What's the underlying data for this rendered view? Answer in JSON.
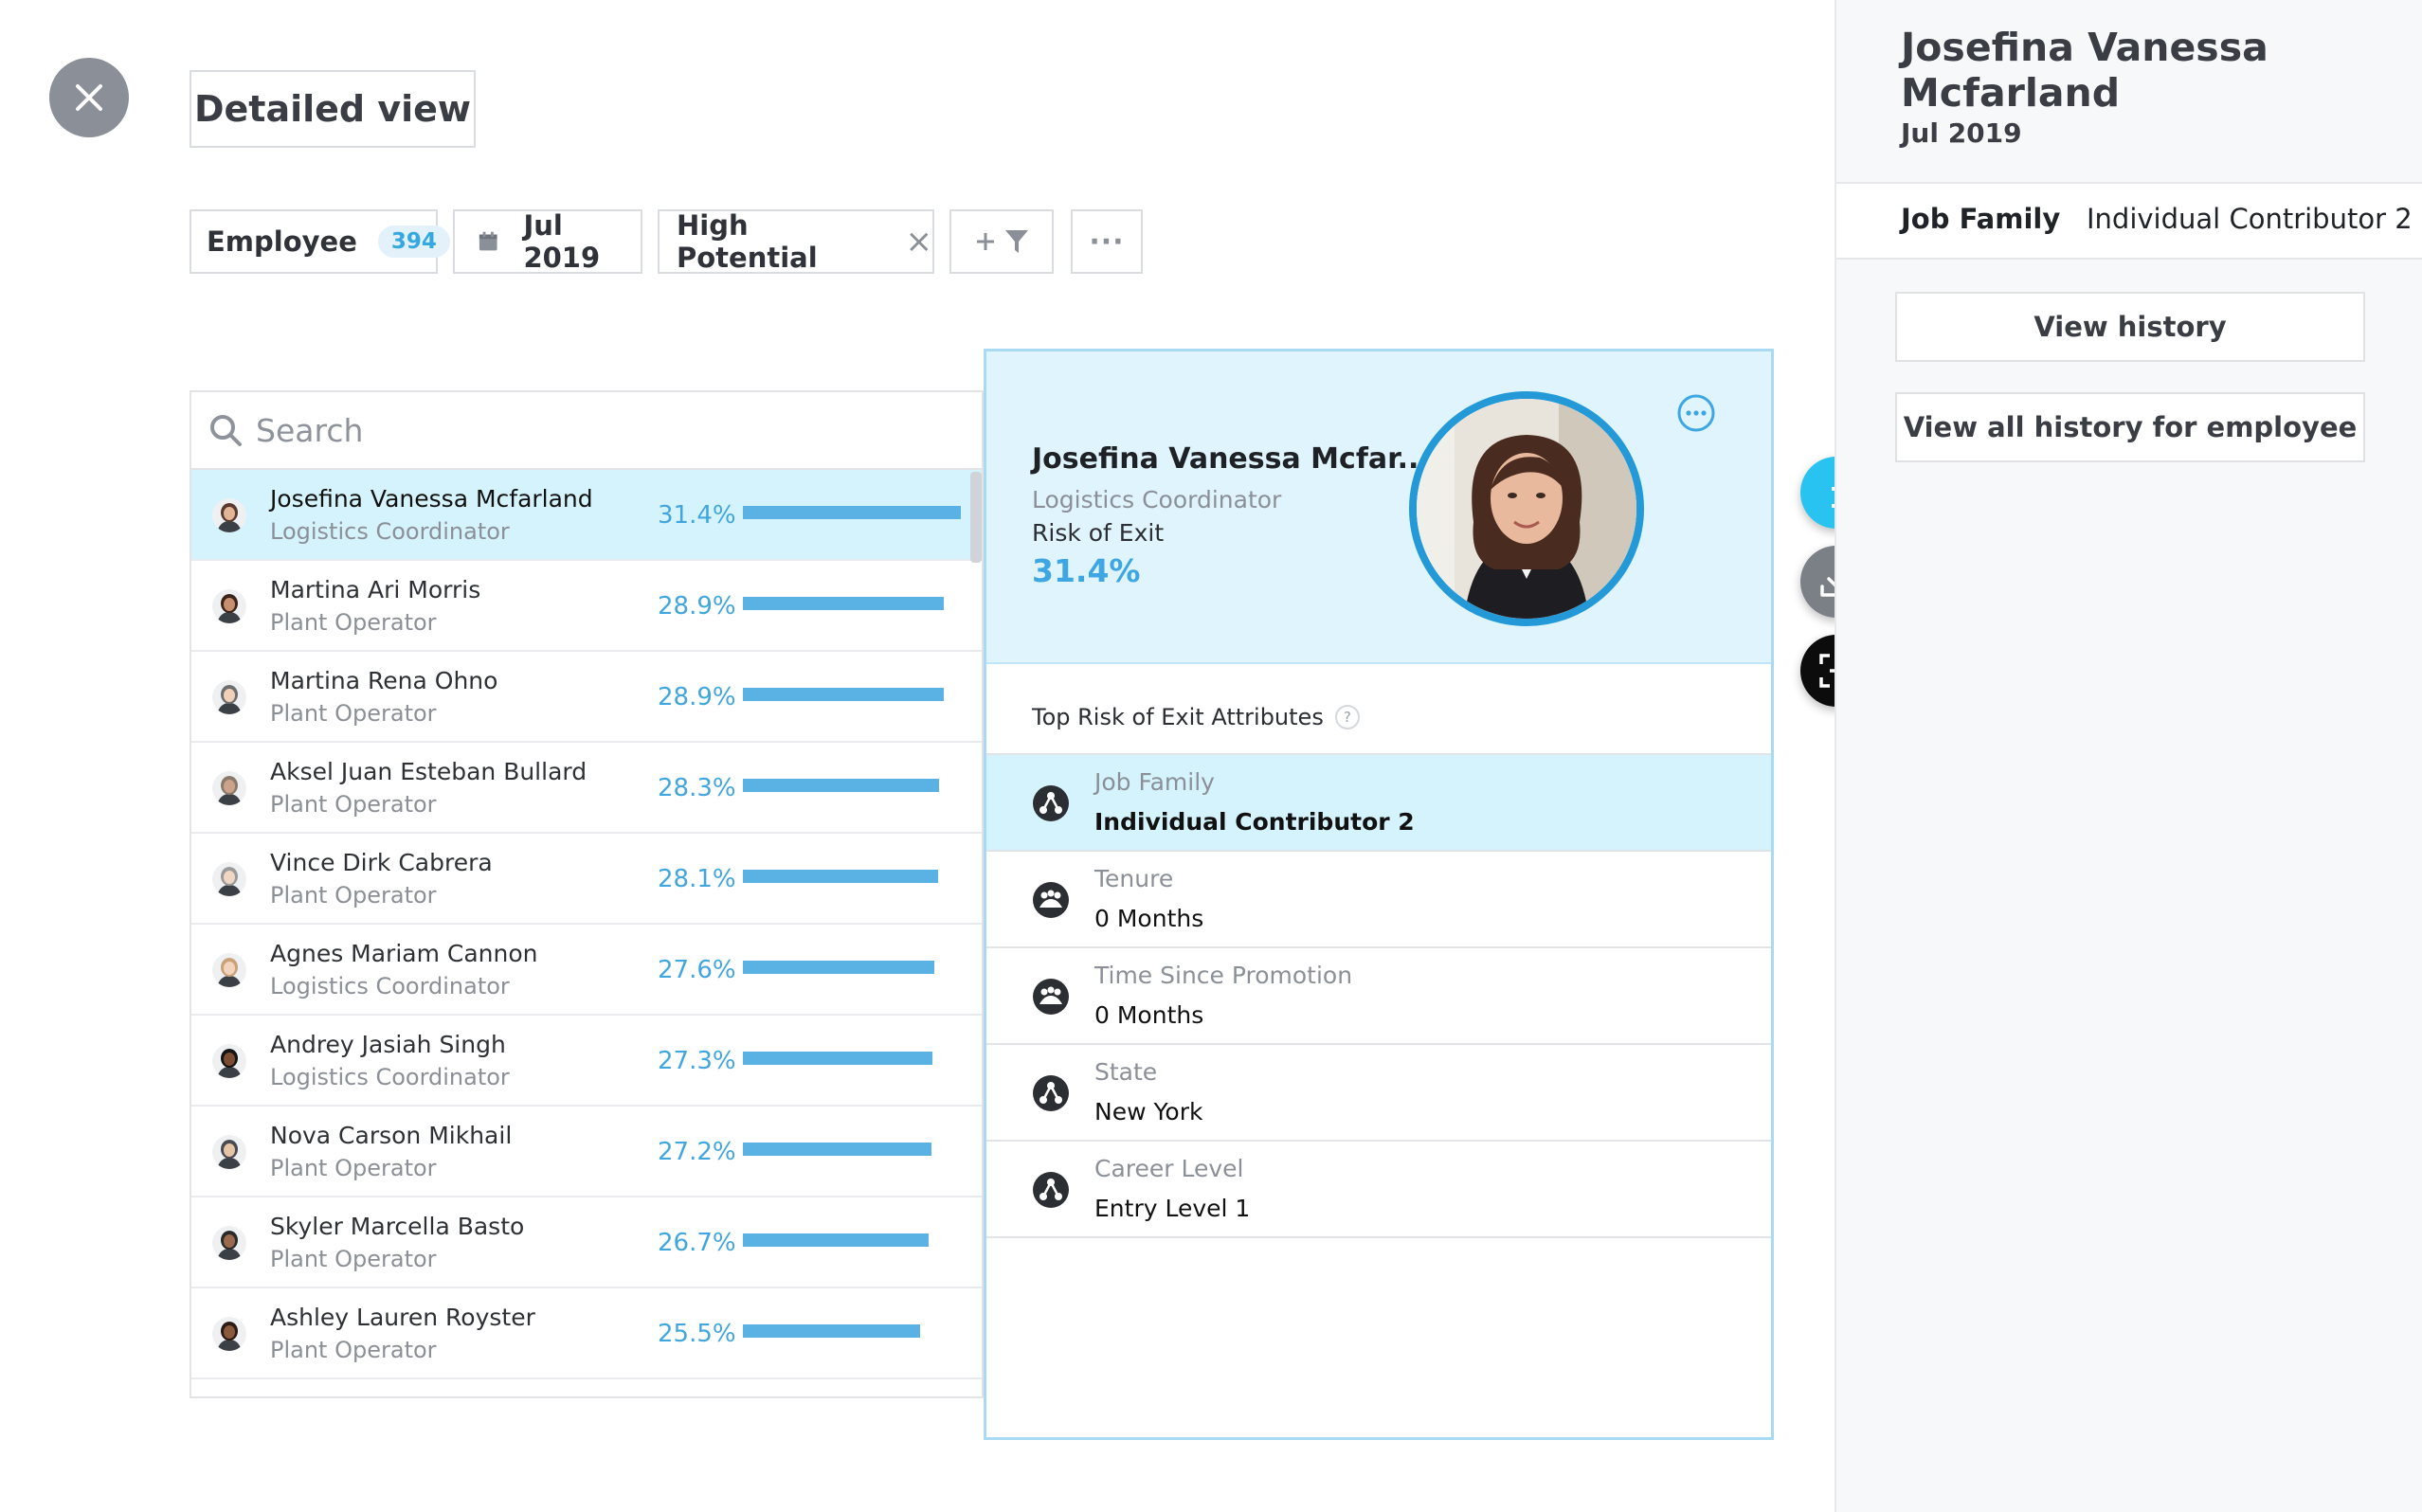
{
  "page": {
    "title": "Detailed view"
  },
  "filters": {
    "employee_label": "Employee",
    "employee_count": "394",
    "date": "Jul 2019",
    "segment": "High Potential",
    "segment_remove": "×",
    "more": "···"
  },
  "search": {
    "placeholder": "Search"
  },
  "employees": [
    {
      "name": "Josefina Vanessa Mcfarland",
      "role": "Logistics Coordinator",
      "risk": "31.4%",
      "risk_value": 31.4,
      "selected": true
    },
    {
      "name": "Martina Ari Morris",
      "role": "Plant Operator",
      "risk": "28.9%",
      "risk_value": 28.9
    },
    {
      "name": "Martina Rena Ohno",
      "role": "Plant Operator",
      "risk": "28.9%",
      "risk_value": 28.9
    },
    {
      "name": "Aksel Juan Esteban Bullard",
      "role": "Plant Operator",
      "risk": "28.3%",
      "risk_value": 28.3
    },
    {
      "name": "Vince Dirk Cabrera",
      "role": "Plant Operator",
      "risk": "28.1%",
      "risk_value": 28.1
    },
    {
      "name": "Agnes Mariam Cannon",
      "role": "Logistics Coordinator",
      "risk": "27.6%",
      "risk_value": 27.6
    },
    {
      "name": "Andrey Jasiah Singh",
      "role": "Logistics Coordinator",
      "risk": "27.3%",
      "risk_value": 27.3
    },
    {
      "name": "Nova Carson Mikhail",
      "role": "Plant Operator",
      "risk": "27.2%",
      "risk_value": 27.2
    },
    {
      "name": "Skyler Marcella Basto",
      "role": "Plant Operator",
      "risk": "26.7%",
      "risk_value": 26.7
    },
    {
      "name": "Ashley Lauren Royster",
      "role": "Plant Operator",
      "risk": "25.5%",
      "risk_value": 25.5
    }
  ],
  "detail": {
    "name": "Josefina Vanessa Mcfar...",
    "role": "Logistics Coordinator",
    "risk_label": "Risk of Exit",
    "risk_value": "31.4%",
    "attributes_title": "Top Risk of Exit Attributes",
    "attributes_help": "?",
    "attributes": [
      {
        "label": "Job Family",
        "value": "Individual Contributor 2",
        "icon": "network-icon",
        "highlight": true
      },
      {
        "label": "Tenure",
        "value": "0 Months",
        "icon": "group-icon"
      },
      {
        "label": "Time Since Promotion",
        "value": "0 Months",
        "icon": "group-icon"
      },
      {
        "label": "State",
        "value": "New York",
        "icon": "network-icon"
      },
      {
        "label": "Career Level",
        "value": "Entry Level 1",
        "icon": "network-icon"
      }
    ]
  },
  "sidebar": {
    "name": "Josefina Vanessa Mcfarland",
    "date": "Jul 2019",
    "field_label": "Job Family",
    "field_value": "Individual Contributor 2",
    "view_history": "View history",
    "view_all_history": "View all history for employee"
  },
  "colors": {
    "accent": "#35a8e0",
    "bar": "#5ab1e3",
    "selected_bg": "#d5f3fc"
  },
  "icons": {
    "close": "close-icon",
    "calendar": "calendar-icon",
    "filter": "filter-icon",
    "search": "search-icon",
    "info": "info-icon",
    "download": "download-icon",
    "capture": "screenshot-icon",
    "more": "more-icon"
  }
}
